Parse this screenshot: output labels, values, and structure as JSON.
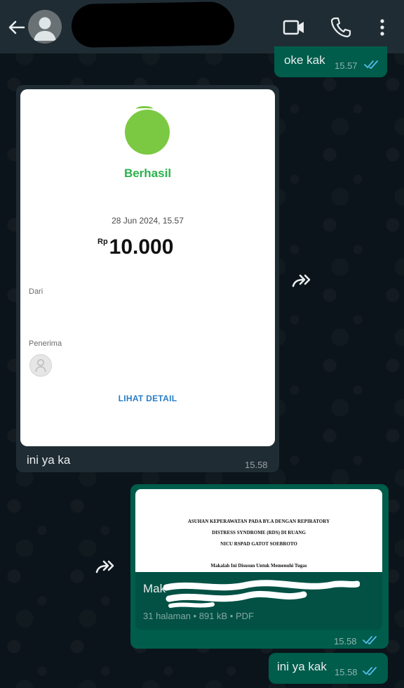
{
  "header": {
    "contact_name": "",
    "icons": [
      "back-arrow-icon",
      "avatar-icon",
      "video-call-icon",
      "voice-call-icon",
      "more-vert-icon"
    ]
  },
  "messages": [
    {
      "direction": "outgoing",
      "text": "oke kak",
      "time": "15.57",
      "status": "read"
    },
    {
      "direction": "incoming",
      "type": "image",
      "receipt": {
        "status": "Berhasil",
        "datetime": "28 Jun 2024, 15.57",
        "currency": "Rp",
        "amount": "10.000",
        "from_label": "Dari",
        "receiver_label": "Penerima",
        "detail_link": "LIHAT DETAIL"
      },
      "caption": "ini ya ka",
      "time": "15.58"
    },
    {
      "direction": "outgoing",
      "type": "document",
      "preview_lines": [
        "ASUHAN KEPERAWATAN PADA BY.A DENGAN REPIRATORY",
        "DISTRESS SYNDROME (RDS) DI RUANG",
        "NICU RSPAD GATOT SOEBROTO",
        "Makalah Ini Disusun Untuk Memenuhi Tugas"
      ],
      "file_name_start": "Mak",
      "file_meta": "31 halaman • 891 kB • PDF",
      "time": "15.58",
      "status": "read"
    },
    {
      "direction": "outgoing",
      "text": "ini ya kak",
      "time": "15.58",
      "status": "read"
    }
  ],
  "colors": {
    "header_bg": "#1f2c34",
    "chat_bg": "#0b141a",
    "outgoing_bubble": "#005c4b",
    "incoming_bubble": "#202c33",
    "read_tick": "#53bdeb",
    "success_green": "#7bc943",
    "link_blue": "#2a7dc3"
  }
}
